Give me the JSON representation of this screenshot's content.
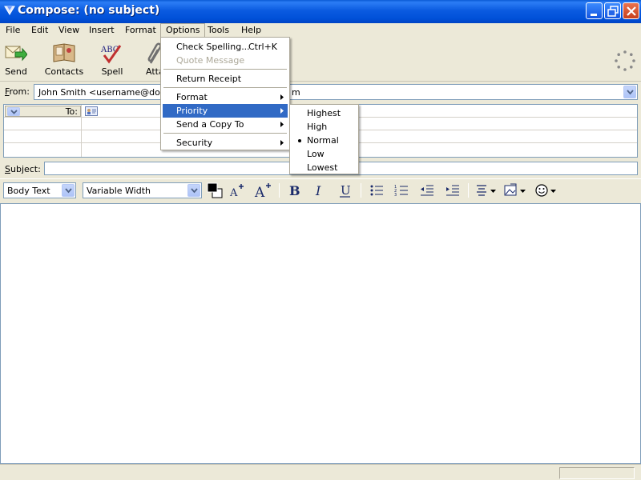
{
  "window": {
    "title": "Compose: (no subject)"
  },
  "menubar": {
    "items": [
      "File",
      "Edit",
      "View",
      "Insert",
      "Format",
      "Options",
      "Tools",
      "Help"
    ]
  },
  "toolbar": {
    "buttons": [
      "Send",
      "Contacts",
      "Spell",
      "Attach"
    ],
    "attach_visible": "Atta"
  },
  "compose": {
    "from_label": "From:",
    "from_value": "John Smith <username@domai",
    "from_value_tail": "m",
    "to_label": "To:",
    "subject_label": "Subject:",
    "subject_value": ""
  },
  "format_toolbar": {
    "paragraph_style": "Body Text",
    "font": "Variable Width",
    "colors": {
      "text": "#000000",
      "background": "#ffffff"
    }
  },
  "options_menu": {
    "items": [
      {
        "label": "Check Spelling...",
        "accel": "Ctrl+K",
        "enabled": true
      },
      {
        "label": "Quote Message",
        "enabled": false
      },
      {
        "label": "Return Receipt",
        "enabled": true
      },
      {
        "label": "Format",
        "submenu": true
      },
      {
        "label": "Priority",
        "submenu": true,
        "highlighted": true
      },
      {
        "label": "Send a Copy To",
        "submenu": true
      },
      {
        "label": "Security",
        "submenu": true
      }
    ]
  },
  "priority_menu": {
    "items": [
      "Highest",
      "High",
      "Normal",
      "Low",
      "Lowest"
    ],
    "selected": "Normal"
  },
  "colors": {
    "titlebar": "#0a5bd6",
    "menu_highlight": "#316ac5",
    "chrome": "#ece9d8"
  },
  "icons": [
    "app-icon",
    "minimize-icon",
    "restore-icon",
    "close-icon",
    "send-icon",
    "contacts-icon",
    "spell-icon",
    "attach-icon",
    "throbber-icon",
    "address-card-icon",
    "bold-icon",
    "italic-icon",
    "underline-icon",
    "bullet-list-icon",
    "numbered-list-icon",
    "outdent-icon",
    "indent-icon",
    "align-icon",
    "insert-icon",
    "smiley-icon"
  ]
}
